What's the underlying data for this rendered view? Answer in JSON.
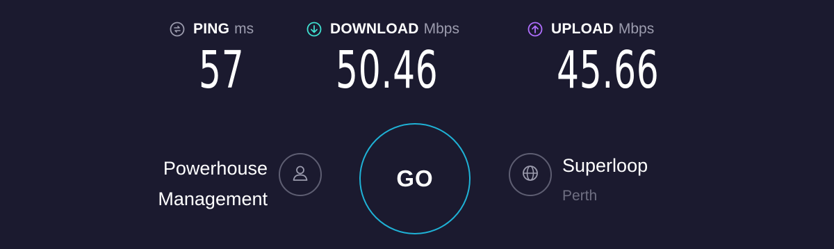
{
  "metrics": {
    "ping": {
      "label": "PING",
      "unit": "ms",
      "value": "57",
      "icon": "ping-icon",
      "color": "#9c9cae"
    },
    "download": {
      "label": "DOWNLOAD",
      "unit": "Mbps",
      "value": "50.46",
      "icon": "download-arrow-icon",
      "color": "#3fe0d0"
    },
    "upload": {
      "label": "UPLOAD",
      "unit": "Mbps",
      "value": "45.66",
      "icon": "upload-arrow-icon",
      "color": "#b06fff"
    }
  },
  "isp": {
    "line1": "Powerhouse",
    "line2": "Management",
    "icon": "user-icon"
  },
  "go_button": {
    "label": "GO",
    "color": "#1fb2d6"
  },
  "server": {
    "name": "Superloop",
    "location": "Perth",
    "icon": "globe-icon"
  },
  "colors": {
    "background": "#1b1a2f",
    "text": "#ffffff",
    "muted": "#9c9cae"
  }
}
